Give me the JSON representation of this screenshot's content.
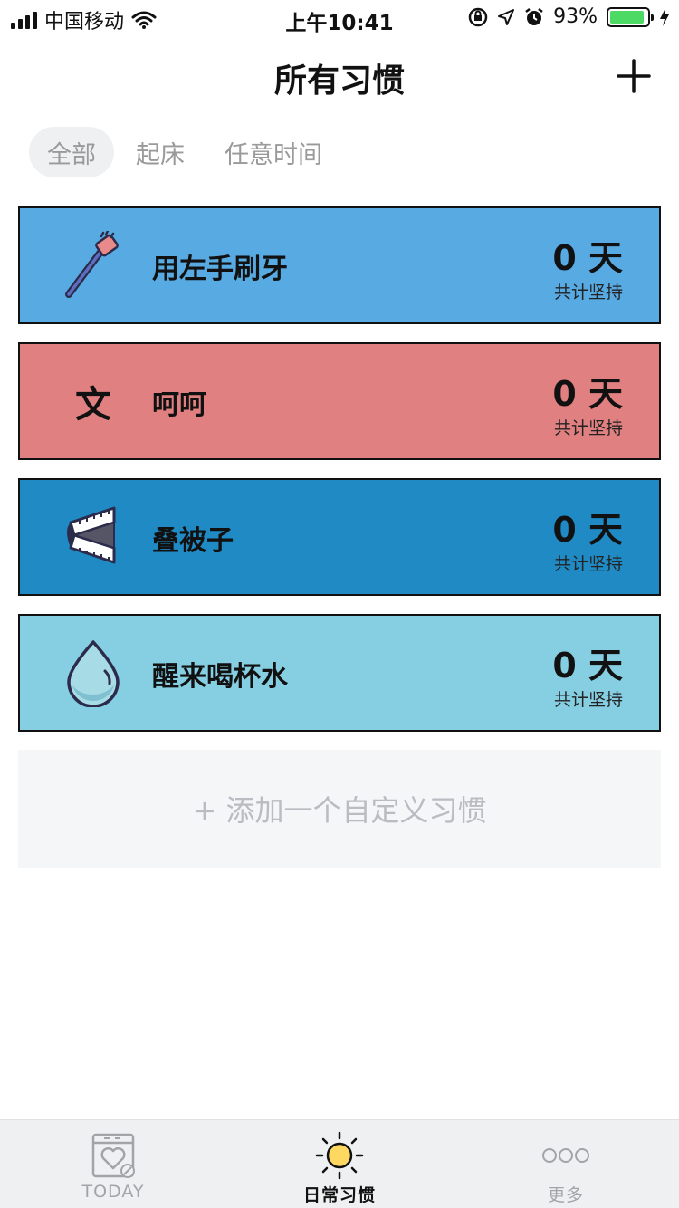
{
  "status_bar": {
    "carrier": "中国移动",
    "time": "上午10:41",
    "battery": "93%",
    "battery_level": 0.93
  },
  "header": {
    "title": "所有习惯"
  },
  "tabs": [
    {
      "label": "全部",
      "active": true
    },
    {
      "label": "起床",
      "active": false
    },
    {
      "label": "任意时间",
      "active": false
    }
  ],
  "habits": [
    {
      "name": "用左手刷牙",
      "count": "0 天",
      "count_label": "共计坚持",
      "color": "#58aae3",
      "icon": "toothbrush-icon"
    },
    {
      "name": "呵呵",
      "count": "0 天",
      "count_label": "共计坚持",
      "color": "#e08080",
      "icon": "text-icon",
      "icon_text": "文"
    },
    {
      "name": "叠被子",
      "count": "0 天",
      "count_label": "共计坚持",
      "color": "#208ac5",
      "icon": "folded-blanket-icon"
    },
    {
      "name": "醒来喝杯水",
      "count": "0 天",
      "count_label": "共计坚持",
      "color": "#86cfe2",
      "icon": "water-drop-icon"
    }
  ],
  "add_custom": "+ 添加一个自定义习惯",
  "tab_bar": [
    {
      "label": "TODAY",
      "icon": "calendar-heart-icon",
      "active": false
    },
    {
      "label": "日常习惯",
      "icon": "sun-icon",
      "active": true
    },
    {
      "label": "更多",
      "icon": "more-icon",
      "active": false
    }
  ],
  "colors": {
    "tab_active_bg": "#eef0f1",
    "add_custom_bg": "#f5f6f8",
    "sun_yellow": "#ffd862",
    "battery_green": "#4cd964"
  }
}
